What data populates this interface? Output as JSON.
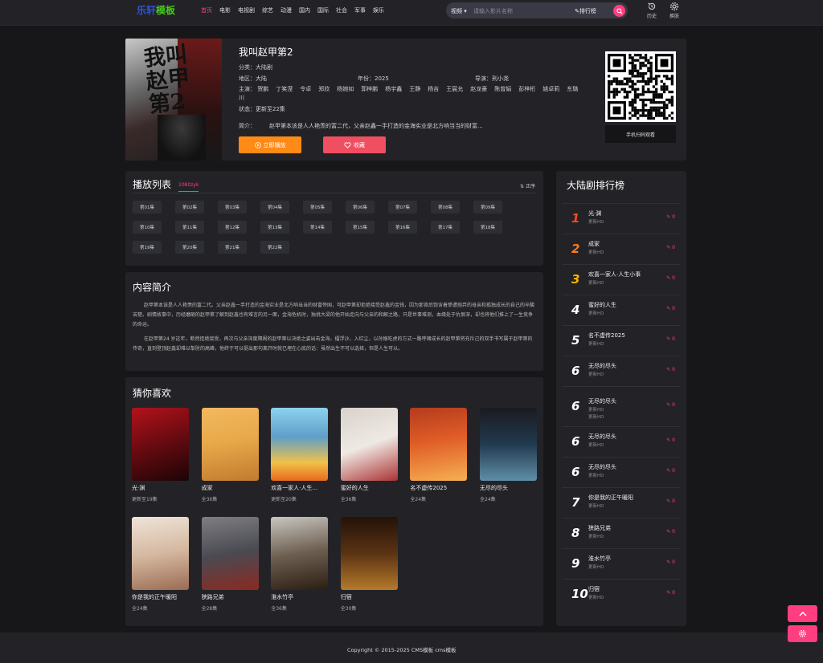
{
  "logo": {
    "part1": "乐轩",
    "part2": "模板"
  },
  "nav": [
    "首页",
    "电影",
    "电视剧",
    "综艺",
    "动漫",
    "国内",
    "国际",
    "社会",
    "军事",
    "娱乐"
  ],
  "search": {
    "select": "视频 ▾",
    "placeholder": "请输入影片名称",
    "rank": "排行榜"
  },
  "toolbar": {
    "history": "历史",
    "skin": "换肤"
  },
  "detail": {
    "title": "我叫赵甲第2",
    "category": "分类：大陆剧",
    "region": "地区：大陆",
    "year": "年份：2025",
    "director": "导演：刑小尧",
    "cast_label": "主演：",
    "cast": [
      "贺鹏",
      "丁笑滢",
      "令卓",
      "郑欣",
      "杨婉如",
      "郭梓鹏",
      "杨宇鑫",
      "王静",
      "杨吉",
      "王宸允",
      "赵龙豪",
      "陈曾娟",
      "彭梓桁",
      "姚卓莉",
      "东璐川"
    ],
    "status": "状态：更新至22集",
    "intro_label": "简介：",
    "intro_short": "赵甲第本该是人人艳羡的富二代，父亲赵鑫一手打造的金海实业是北方响当当的财富...",
    "play_label": "立即播放",
    "fav_label": "收藏",
    "qr_label": "手机扫码观看"
  },
  "playlist": {
    "title": "播放列表",
    "source": "1080zyk",
    "sort": "正序",
    "episodes": [
      "第01集",
      "第02集",
      "第03集",
      "第04集",
      "第05集",
      "第06集",
      "第07集",
      "第08集",
      "第09集",
      "第10集",
      "第11集",
      "第12集",
      "第13集",
      "第14集",
      "第15集",
      "第16集",
      "第17集",
      "第18集",
      "第19集",
      "第20集",
      "第21集",
      "第22集"
    ]
  },
  "intro": {
    "title": "内容简介",
    "p1": "赵甲第本该是人人艳羡的富二代。父亲赵鑫一手打造的金海实业是北方响当当的财富帝国，可赵甲第却拒绝接受赵鑫的金钱，因为那背后饱含着惨遭抛弃的母亲和孤独成长的自己的辛酸苦楚。剧情故事中，历经磨砺的赵甲第了解到赵鑫也有难言的另一面，金海危机时，独挑大梁的他开始走向与父亲的和解之路，只是世事难测，血缘处于仇恨深，却也将他们推上了一生竞争的命运。",
    "p2": "在赵甲第24 岁这年，断然拒绝接受，再次与父亲深度隔阂的赵甲第以决绝之姿出击金海，擂浮沙，入红尘，以孙猴吃虎的方式一路呼啸成长的赵甲第将充斥己的双手书写属于赵甲第的传奇，直到登顶赵鑫却难以掣肘的高峰，他终于可以挺出那句离开时就已埋在心底的话：虽然出生不可以选择，但是人生可以。"
  },
  "guess": {
    "title": "猜你喜欢",
    "items": [
      {
        "title": "光·渊",
        "sub": "更新至19集"
      },
      {
        "title": "成家",
        "sub": "全36集"
      },
      {
        "title": "欢喜一家人·人生...",
        "sub": "更新至20集"
      },
      {
        "title": "蜜好的人生",
        "sub": "全36集"
      },
      {
        "title": "名不虚传2025",
        "sub": "全24集"
      },
      {
        "title": "无尽的尽头",
        "sub": "全24集"
      },
      {
        "title": "你是我的正午暖阳",
        "sub": "全24集"
      },
      {
        "title": "狭路兄弟",
        "sub": "全28集"
      },
      {
        "title": "淮水竹亭",
        "sub": "全36集"
      },
      {
        "title": "归宿",
        "sub": "全30集"
      }
    ]
  },
  "rank": {
    "title": "大陆剧排行榜",
    "items": [
      {
        "num": "1",
        "name": "光·渊",
        "sub": "更新HD",
        "hot": "0"
      },
      {
        "num": "2",
        "name": "成家",
        "sub": "更新HD",
        "hot": "0"
      },
      {
        "num": "3",
        "name": "欢喜一家人·人生小事",
        "sub": "更新HD",
        "hot": "0"
      },
      {
        "num": "4",
        "name": "蜜好的人生",
        "sub": "更新HD",
        "hot": "0"
      },
      {
        "num": "5",
        "name": "名不虚传2025",
        "sub": "更新HD",
        "hot": "0"
      },
      {
        "num": "6",
        "name": "无尽的尽头",
        "sub": "更新HD",
        "hot": "0"
      },
      {
        "num": "6",
        "name": "无尽的尽头",
        "sub": "更新HD",
        "sub2": "更新HD",
        "hot": "0"
      },
      {
        "num": "6",
        "name": "无尽的尽头",
        "sub": "更新HD",
        "hot": "0"
      },
      {
        "num": "6",
        "name": "无尽的尽头",
        "sub": "更新HD",
        "hot": "0"
      },
      {
        "num": "7",
        "name": "你是我的正午暖阳",
        "sub": "更新HD",
        "hot": "0"
      },
      {
        "num": "8",
        "name": "狭路兄弟",
        "sub": "更新HD",
        "hot": "0"
      },
      {
        "num": "9",
        "name": "淮水竹亭",
        "sub": "更新HD",
        "hot": "0"
      },
      {
        "num": "10",
        "name": "归宿",
        "sub": "更新HD",
        "hot": "0"
      }
    ]
  },
  "footer": "Copyright © 2015-2025 CMS模板 cms模板",
  "colors": {
    "accent": "#ff3d7f",
    "play": "#ff8a16",
    "fav": "#f04e61",
    "panel": "#232327",
    "bg": "#171719"
  }
}
